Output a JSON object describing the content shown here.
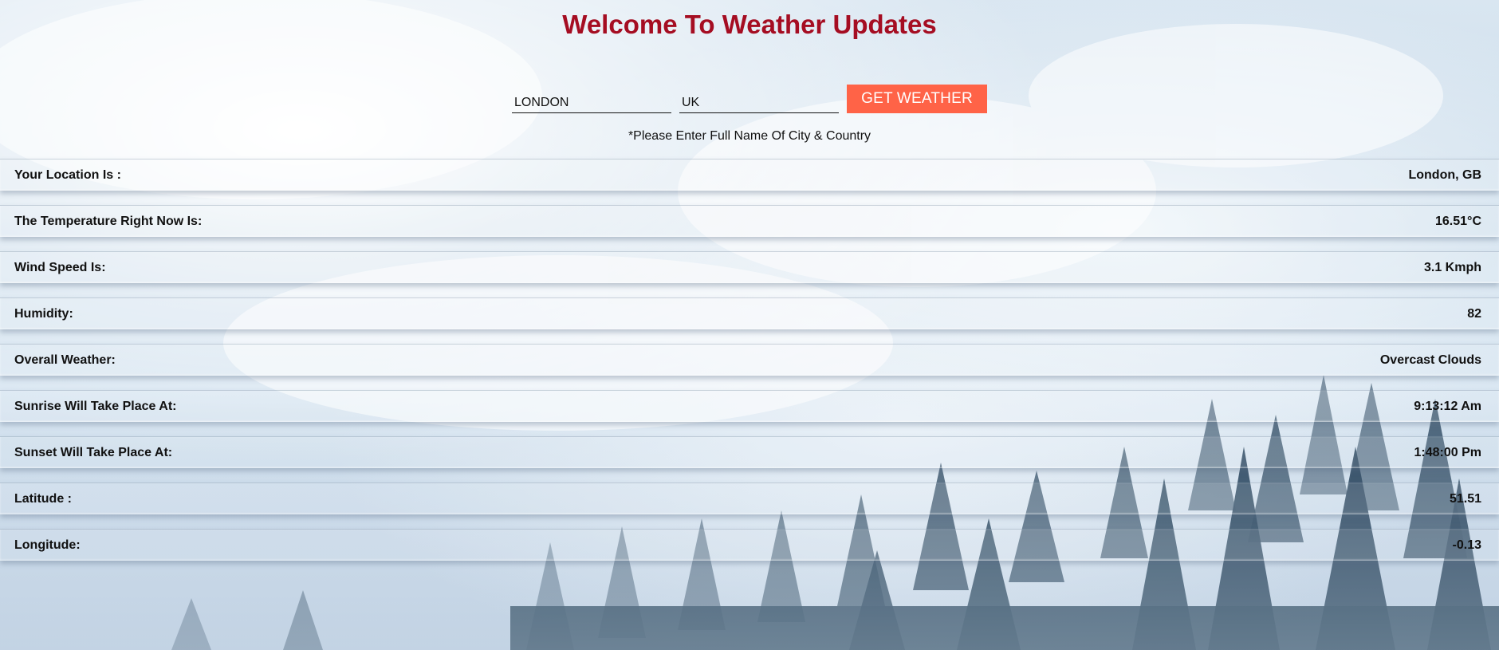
{
  "page": {
    "title": "Welcome To Weather Updates",
    "hint": "*Please Enter Full Name Of City & Country"
  },
  "form": {
    "city_value": "LONDON",
    "country_value": "UK",
    "button_label": "GET WEATHER"
  },
  "rows": [
    {
      "label": "Your Location Is :",
      "value": "London, GB"
    },
    {
      "label": "The Temperature Right Now Is:",
      "value": "16.51°C"
    },
    {
      "label": "Wind Speed Is:",
      "value": "3.1 Kmph"
    },
    {
      "label": "Humidity:",
      "value": "82"
    },
    {
      "label": "Overall Weather:",
      "value": "Overcast Clouds"
    },
    {
      "label": "Sunrise Will Take Place At:",
      "value": "9:13:12 Am"
    },
    {
      "label": "Sunset Will Take Place At:",
      "value": "1:48:00 Pm"
    },
    {
      "label": "Latitude :",
      "value": "51.51"
    },
    {
      "label": "Longitude:",
      "value": "-0.13"
    }
  ],
  "colors": {
    "title": "#a50d22",
    "button": "#ff6347",
    "trees": "#2f4b63"
  }
}
